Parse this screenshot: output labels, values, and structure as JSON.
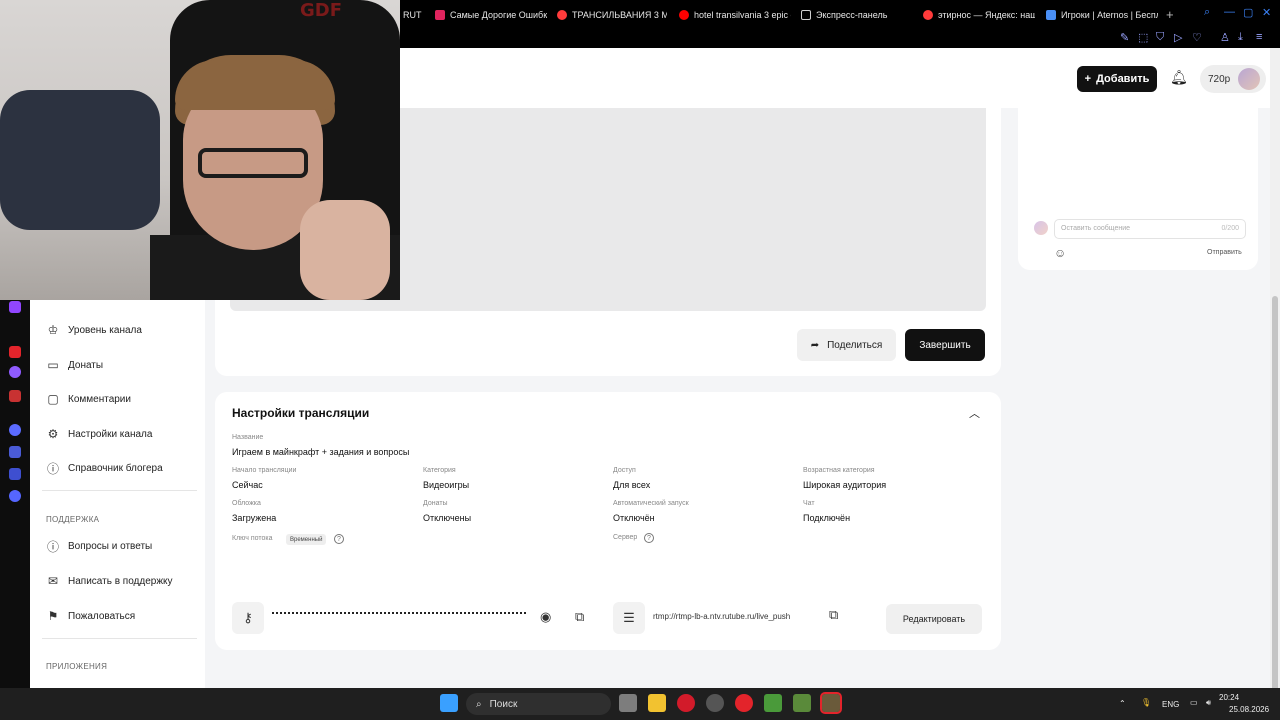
{
  "browser": {
    "tabs": [
      {
        "label": "RUT",
        "color": "#ff5a5a"
      },
      {
        "label": "Самые Дорогие Ошибк",
        "color": "#e0245e"
      },
      {
        "label": "ТРАНСИЛЬВАНИЯ 3 МУ",
        "color": "#ff3b3b"
      },
      {
        "label": "hotel transilvania 3 epic e",
        "color": "#ff0000"
      },
      {
        "label": "Экспресс-панель",
        "color": "#cfcfcf"
      },
      {
        "label": "этирнос — Яндекс: наш",
        "color": "#ff3b3b"
      },
      {
        "label": "Игроки | Aternos | Беспл",
        "color": "#4a8ff5"
      }
    ],
    "new_tab": "+"
  },
  "header": {
    "add_label": "Добавить",
    "quality": "720p"
  },
  "sidebar": {
    "items": [
      {
        "label": "Уровень канала",
        "icon": "trophy-icon",
        "glyph": "♔"
      },
      {
        "label": "Донаты",
        "icon": "wallet-icon",
        "glyph": "▭"
      },
      {
        "label": "Комментарии",
        "icon": "comment-icon",
        "glyph": "▢"
      },
      {
        "label": "Настройки канала",
        "icon": "gear-icon",
        "glyph": "⚙"
      },
      {
        "label": "Справочник блогера",
        "icon": "info-icon",
        "glyph": "ⓘ"
      }
    ],
    "support_title": "ПОДДЕРЖКА",
    "support_items": [
      {
        "label": "Вопросы и ответы",
        "icon": "help-icon",
        "glyph": "?"
      },
      {
        "label": "Написать в поддержку",
        "icon": "mail-icon",
        "glyph": "✉"
      },
      {
        "label": "Пожаловаться",
        "icon": "flag-icon",
        "glyph": "⚑"
      }
    ],
    "apps_title": "ПРИЛОЖЕНИЯ"
  },
  "player": {
    "share_label": "Поделиться",
    "finish_label": "Завершить"
  },
  "chat": {
    "placeholder": "Оставить сообщение",
    "counter": "0/200",
    "send_label": "Отправить"
  },
  "settings": {
    "title": "Настройки трансляции",
    "name_label": "Название",
    "name_value": "Играем в майнкрафт + задания и вопросы",
    "fields": [
      {
        "label": "Начало трансляции",
        "value": "Сейчас"
      },
      {
        "label": "Категория",
        "value": "Видеоигры"
      },
      {
        "label": "Доступ",
        "value": "Для всех"
      },
      {
        "label": "Возрастная категория",
        "value": "Широкая аудитория"
      },
      {
        "label": "Обложка",
        "value": "Загружена"
      },
      {
        "label": "Донаты",
        "value": "Отключены"
      },
      {
        "label": "Автоматический запуск",
        "value": "Отключён"
      },
      {
        "label": "Чат",
        "value": "Подключён"
      }
    ],
    "stream_key_label": "Ключ потока",
    "stream_key_badge": "Временный",
    "server_label": "Сервер",
    "server_url": "rtmp://rtmp-lb-a.ntv.rutube.ru/live_push",
    "edit_label": "Редактировать"
  },
  "webcam": {
    "chair_logo": "GDF"
  },
  "taskbar": {
    "search_label": "Поиск",
    "lang": "ENG",
    "time": "20:24",
    "date": "25.08.2026"
  }
}
